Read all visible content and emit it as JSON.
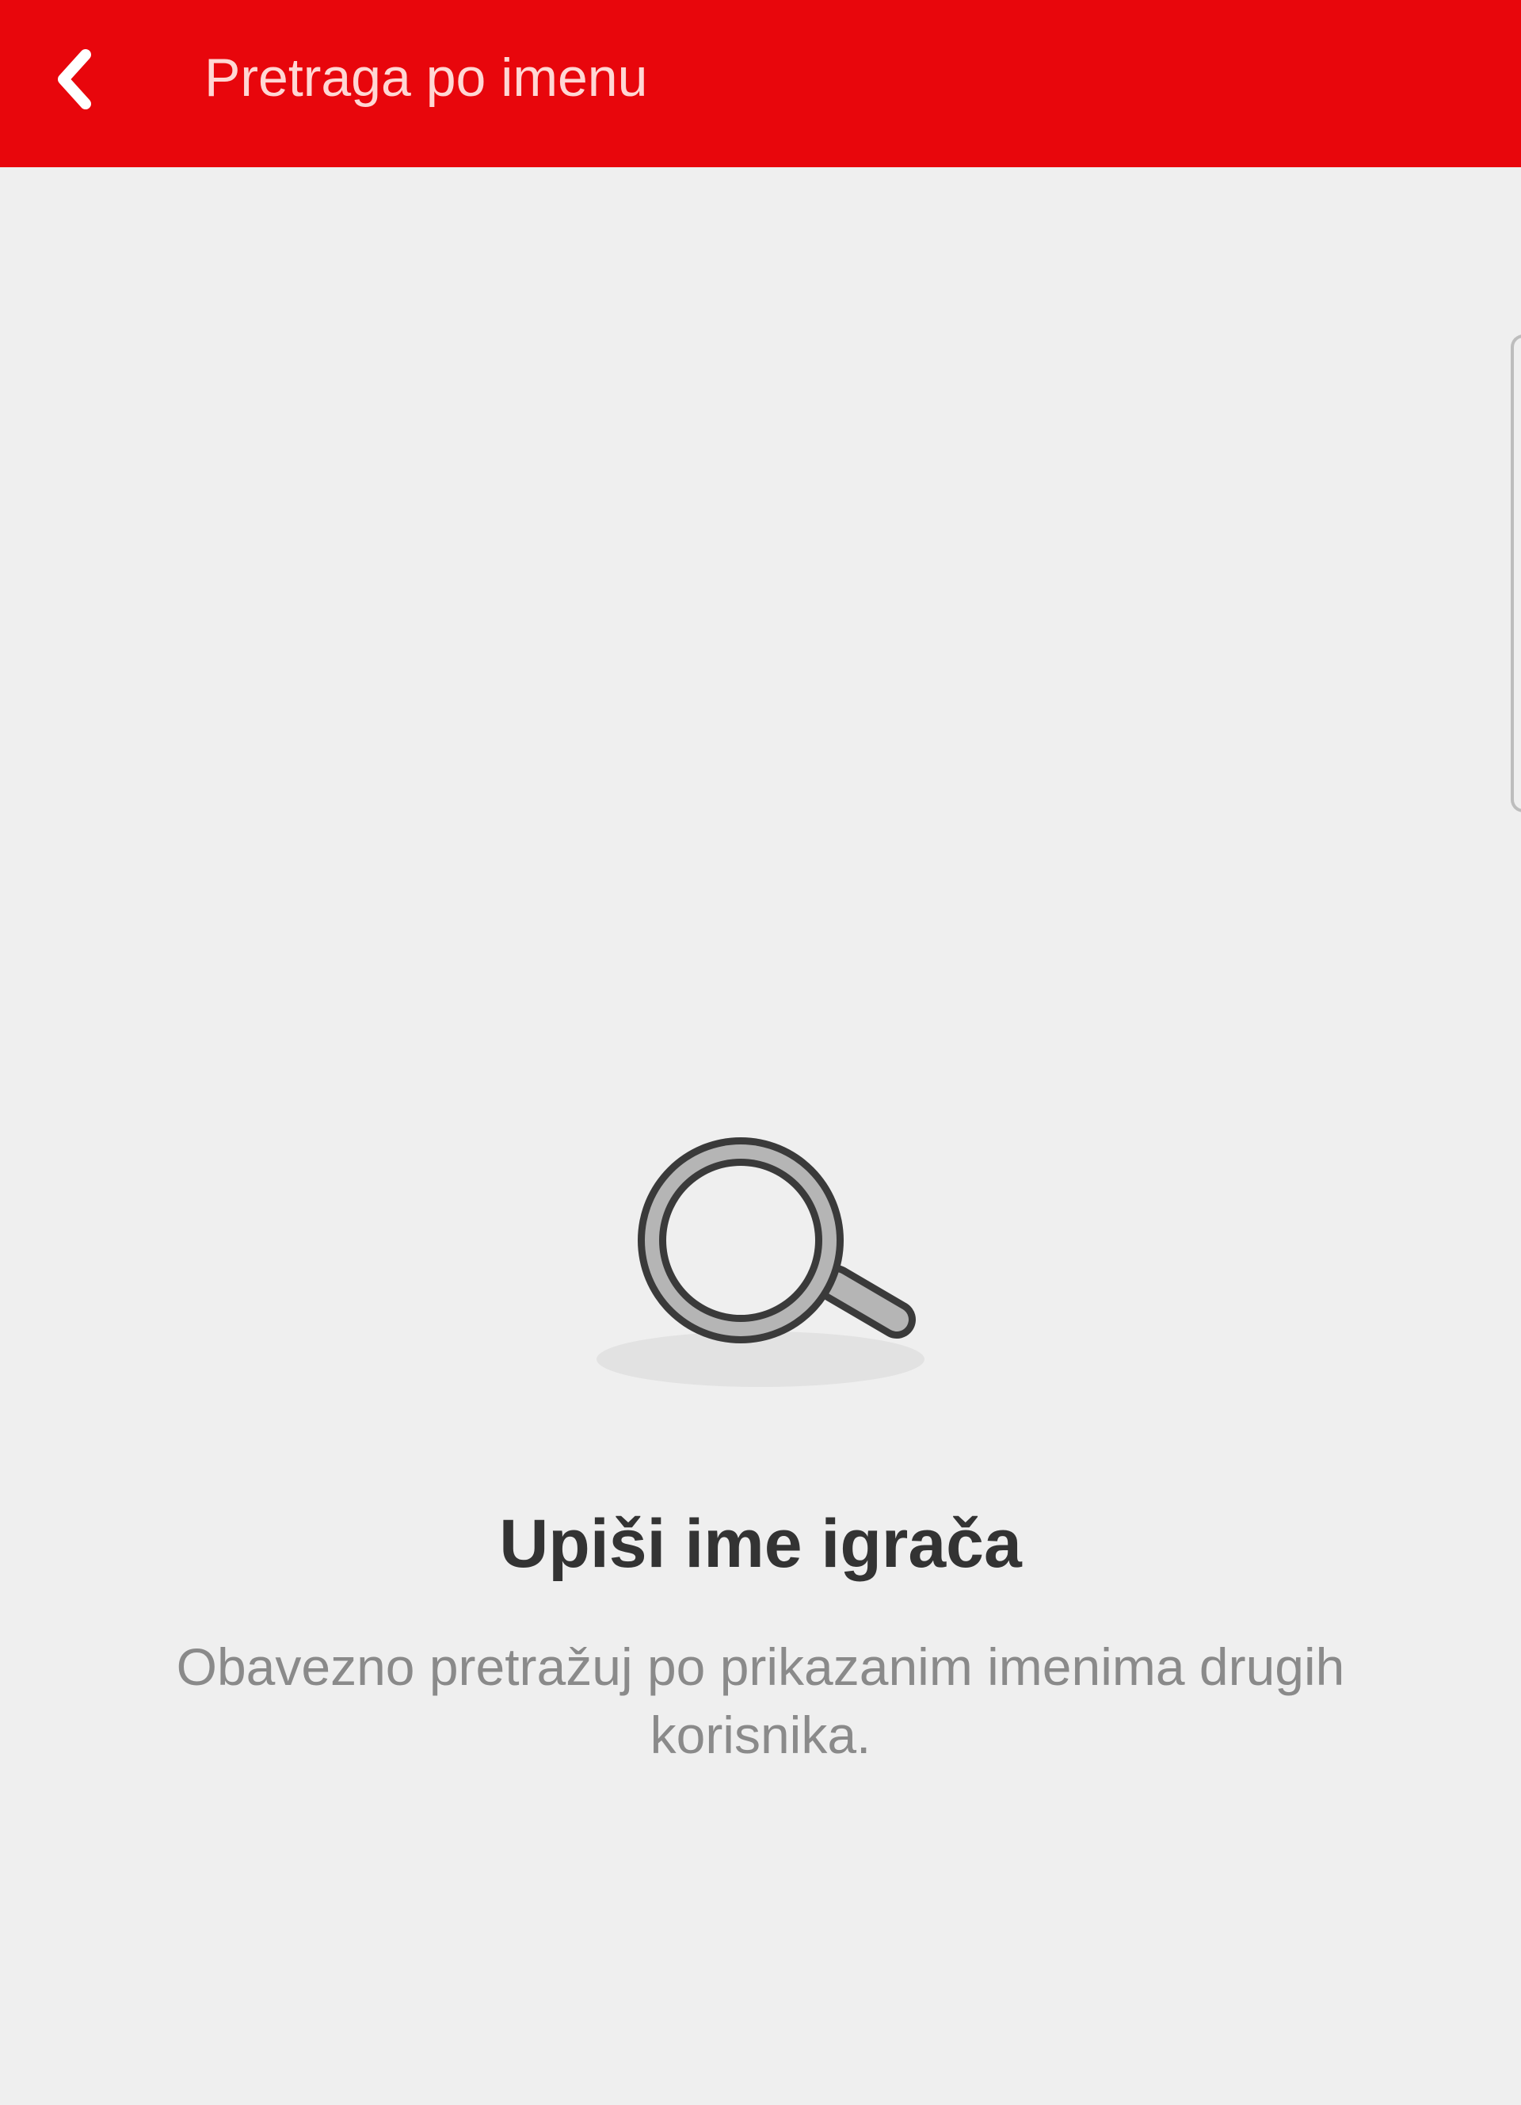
{
  "header": {
    "title": "Pretraga po imenu",
    "back_icon": "chevron-left-icon",
    "background_color": "#e8060c"
  },
  "empty_state": {
    "icon": "search-icon",
    "title": "Upiši ime igrača",
    "subtitle": "Obavezno pretražuj po prikazanim imenima drugih korisnika."
  }
}
